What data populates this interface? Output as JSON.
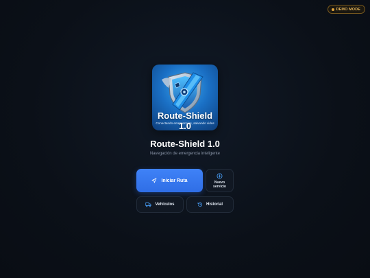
{
  "badge": {
    "label": "DEMO MODE",
    "color": "#e2b45a"
  },
  "logo": {
    "title": "Route-Shield 1.0",
    "tagline": "Conectando emergencias, salvando vidas",
    "icon": "shield-route-icon"
  },
  "app": {
    "title": "Route-Shield 1.0",
    "subtitle": "Navegación de emergencia inteligente"
  },
  "actions": {
    "start": {
      "label": "Iniciar Ruta",
      "icon": "navigation-arrow-icon",
      "color": "#3f82f7"
    },
    "new_service": {
      "label_line1": "Nuevo",
      "label_line2": "servicio",
      "icon": "plus-circle-icon"
    },
    "vehicles": {
      "label": "Vehículos",
      "icon": "truck-icon"
    },
    "history": {
      "label": "Historial",
      "icon": "history-clock-icon"
    }
  },
  "colors": {
    "background": "#0b1018",
    "accent": "#3f82f7",
    "icon_accent": "#4aa3ff"
  }
}
